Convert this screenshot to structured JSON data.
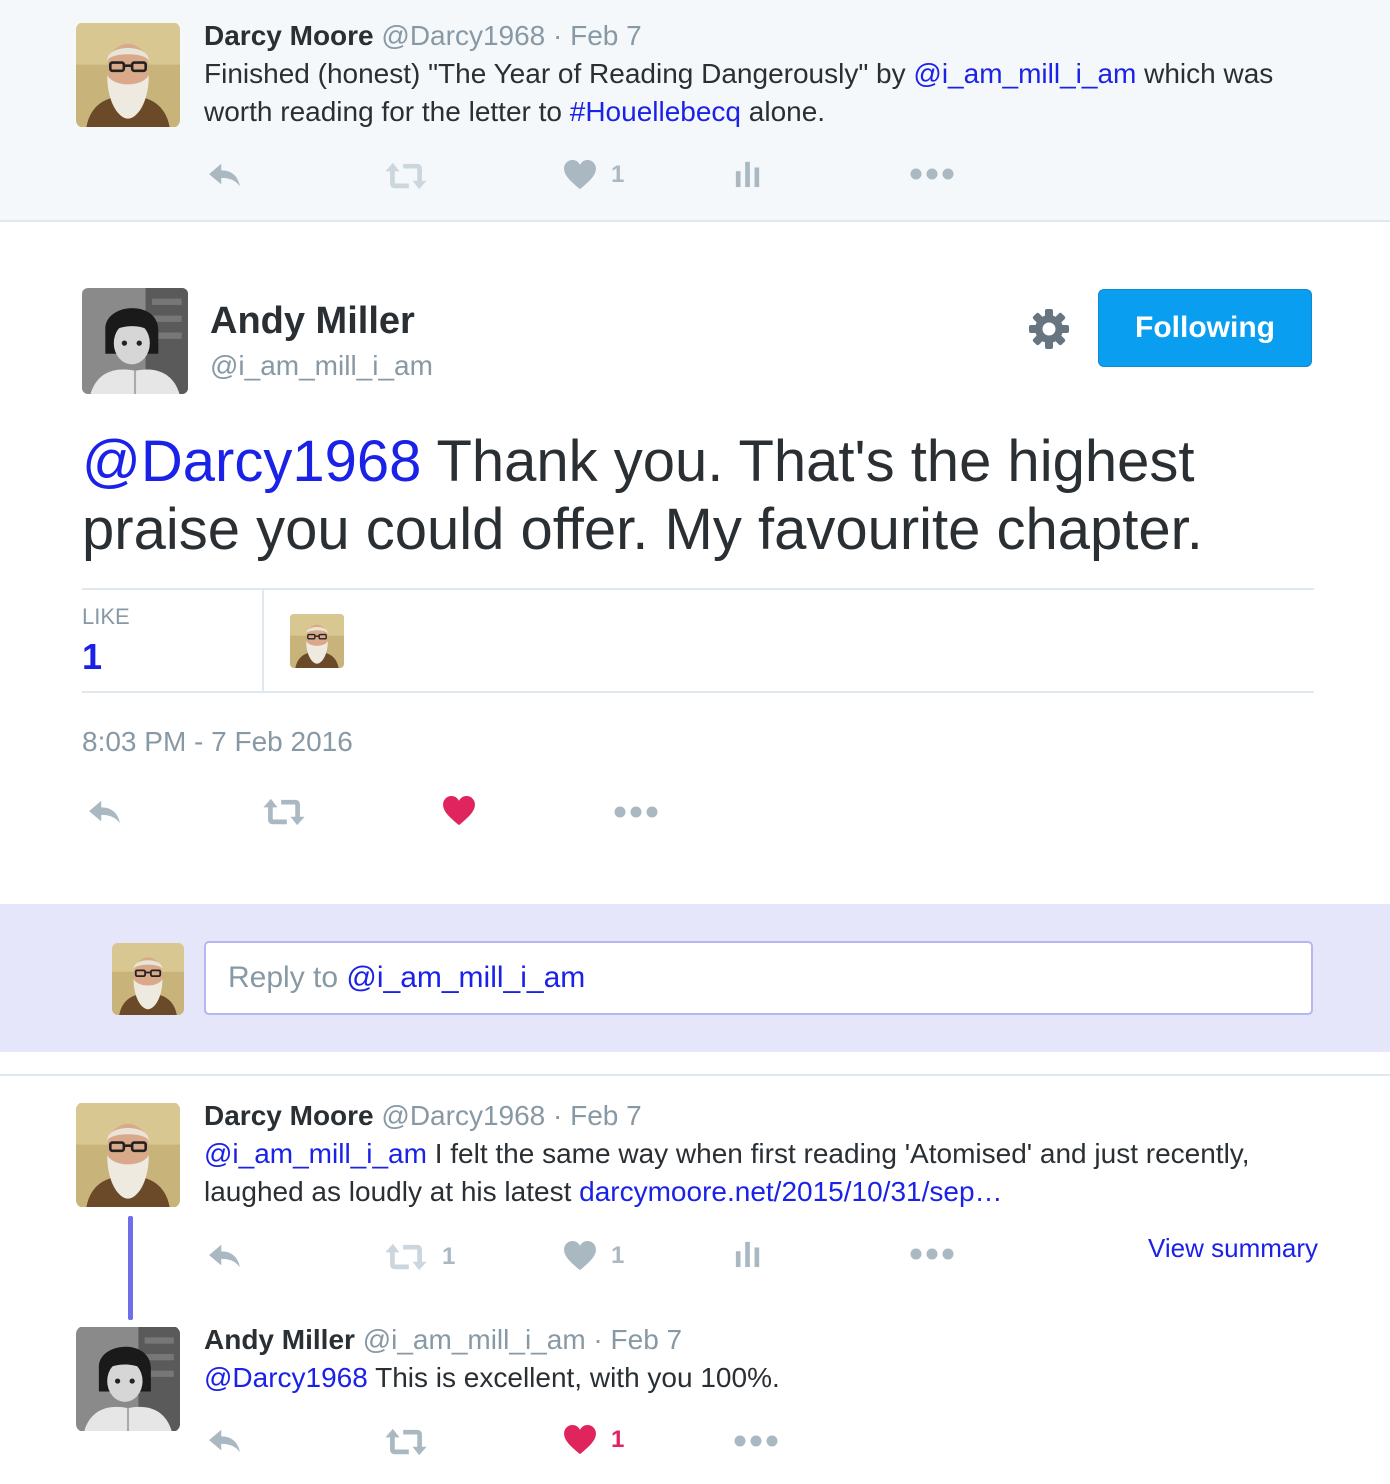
{
  "tweets": {
    "top": {
      "name": "Darcy Moore",
      "handle": "@Darcy1968",
      "date": "· Feb 7",
      "text_parts": {
        "p1": "Finished (honest) \"The Year of Reading Dangerously\" by ",
        "mention": "@i_am_mill_i_am",
        "p2": " which was worth reading for the letter to ",
        "hashtag": "#Houellebecq",
        "p3": " alone."
      },
      "like_count": "1"
    },
    "main": {
      "name": "Andy Miller",
      "handle": "@i_am_mill_i_am",
      "follow_label": "Following",
      "mention": "@Darcy1968",
      "text": " Thank you. That's the highest praise you could offer. My favourite chapter.",
      "like_label": "LIKE",
      "like_count": "1",
      "timestamp": "8:03 PM - 7 Feb 2016"
    },
    "reply_box": {
      "prefix": "Reply to ",
      "mention": "@i_am_mill_i_am"
    },
    "reply1": {
      "name": "Darcy Moore",
      "handle": "@Darcy1968",
      "date": "· Feb 7",
      "mention": "@i_am_mill_i_am",
      "text": " I felt the same way when first reading 'Atomised' and just recently, laughed as loudly at his latest ",
      "link": "darcymoore.net/2015/10/31/sep…",
      "retweet_count": "1",
      "like_count": "1",
      "view_summary": "View summary"
    },
    "reply2": {
      "name": "Andy Miller",
      "handle": "@i_am_mill_i_am",
      "date": "· Feb 7",
      "mention": "@Darcy1968",
      "text": " This is excellent, with you 100%.",
      "like_count": "1"
    }
  },
  "colors": {
    "link": "#1b22e8",
    "follow_button": "#0a9ef0",
    "like_red": "#e0245e",
    "reply_bar_bg": "#e6e6fa",
    "muted": "#8899a6"
  },
  "icons": [
    "reply-icon",
    "retweet-icon",
    "heart-icon",
    "analytics-icon",
    "more-icon",
    "gear-icon"
  ]
}
